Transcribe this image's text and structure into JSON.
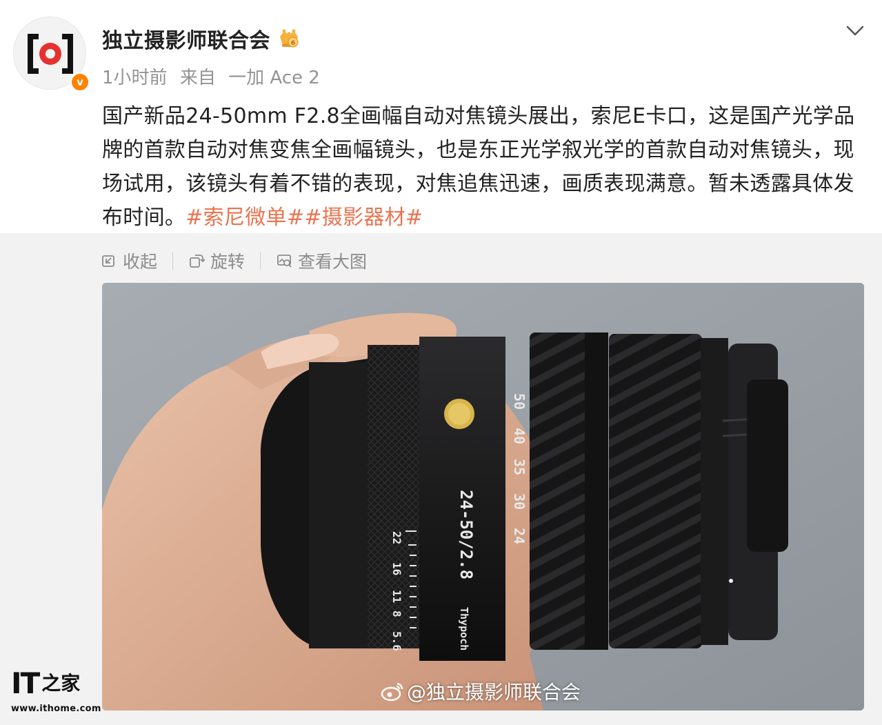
{
  "post": {
    "author": {
      "name": "独立摄影师联合会",
      "verified": true,
      "badge_icon": "vip-crown-icon",
      "brand_color": "#e5312f",
      "verified_color": "#ff8200"
    },
    "meta": {
      "time": "1小时前",
      "from_label": "来自",
      "device": "一加 Ace 2"
    },
    "body_text": "国产新品24-50mm F2.8全画幅自动对焦镜头展出，索尼E卡口，这是国产光学品牌的首款自动对焦变焦全画幅镜头，也是东正光学叙光学的首款自动对焦镜头，现场试用，该镜头有着不错的表现，对焦追焦迅速，画质表现满意。暂未透露具体发布时间。",
    "hashtags": [
      "#索尼微单#",
      "#摄影器材#"
    ],
    "hashtag_color": "#eb7350"
  },
  "toolbar": {
    "collapse_label": "收起",
    "rotate_label": "旋转",
    "view_large_label": "查看大图"
  },
  "image": {
    "lens_markings": {
      "focal_lengths": [
        "50",
        "40",
        "35",
        "30",
        "24"
      ],
      "model": "24-50/2.8",
      "aperture_scale": [
        "22",
        "16",
        "11",
        "8",
        "5.6"
      ],
      "brand_script": "Thypoch"
    },
    "watermark": "@独立摄影师联合会"
  },
  "site_logo": {
    "letters": "IT",
    "char": "之家",
    "url": "www.ithome.com"
  }
}
